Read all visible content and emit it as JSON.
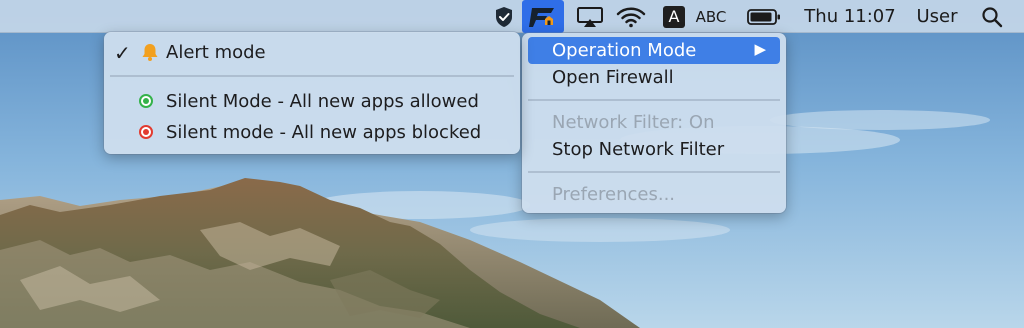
{
  "menubar": {
    "input_source": "ABC",
    "input_badge": "A",
    "clock": "Thu 11:07",
    "user": "User",
    "icons": [
      "shield-check-icon",
      "firewall-app-icon",
      "airplay-icon",
      "wifi-icon",
      "input-source-icon",
      "battery-icon",
      "spotlight-search-icon"
    ]
  },
  "app_menu": {
    "items": [
      {
        "label": "Operation Mode",
        "state": "highlighted",
        "has_submenu": true
      },
      {
        "label": "Open Firewall",
        "state": "enabled"
      },
      {
        "label": "Network Filter: On",
        "state": "disabled"
      },
      {
        "label": "Stop Network Filter",
        "state": "enabled"
      },
      {
        "label": "Preferences...",
        "state": "disabled"
      }
    ],
    "submenu_arrow": "▶"
  },
  "operation_mode_submenu": {
    "items": [
      {
        "label": "Alert mode",
        "checked": true,
        "icon": "bell-icon"
      },
      {
        "label": "Silent Mode - All new apps allowed",
        "icon": "green-dot-icon"
      },
      {
        "label": "Silent mode - All new apps blocked",
        "icon": "red-dot-icon"
      }
    ],
    "check_mark": "✓"
  },
  "colors": {
    "highlight": "#3f7fe6",
    "allowed": "#34b24a",
    "blocked": "#e23b30",
    "bell": "#f2a01f"
  }
}
